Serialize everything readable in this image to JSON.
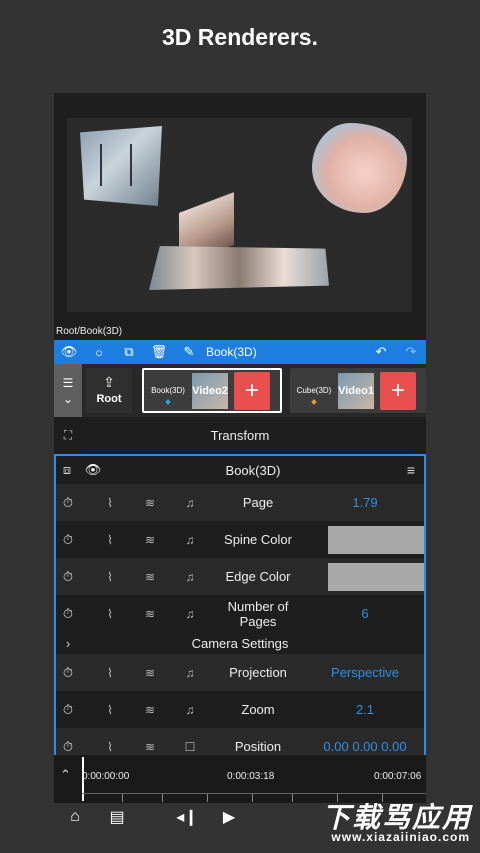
{
  "title": "3D Renderers.",
  "path": "Root/Book(3D)",
  "toolbar": {
    "layer_name": "Book(3D)"
  },
  "layers": {
    "root_label": "Root",
    "cards": [
      {
        "name": "Book(3D)",
        "thumb": "Video2"
      },
      {
        "name": "Cube(3D)",
        "thumb": "Video1"
      }
    ]
  },
  "transform_label": "Transform",
  "panel": {
    "title": "Book(3D)",
    "rows": [
      {
        "name": "Page",
        "value": "1.79"
      },
      {
        "name": "Spine Color"
      },
      {
        "name": "Edge Color"
      },
      {
        "name": "Number of Pages",
        "value": "6"
      }
    ],
    "section": "Camera Settings",
    "camera_rows": [
      {
        "name": "Projection",
        "value": "Perspective"
      },
      {
        "name": "Zoom",
        "value": "2.1"
      },
      {
        "name": "Position",
        "value": "0.00 0.00 0.00"
      }
    ]
  },
  "timeline": {
    "t0": "0:00:00:00",
    "t1": "0:00:03:18",
    "t2": "0:00:07:06"
  },
  "watermark": {
    "main": "下载骂应用",
    "sub": "www.xiazaiiniao.com"
  },
  "colors": {
    "accent": "#1e7ee0",
    "value": "#2d8fe8",
    "plus": "#e85050",
    "swatch": "#a9a9a9"
  }
}
